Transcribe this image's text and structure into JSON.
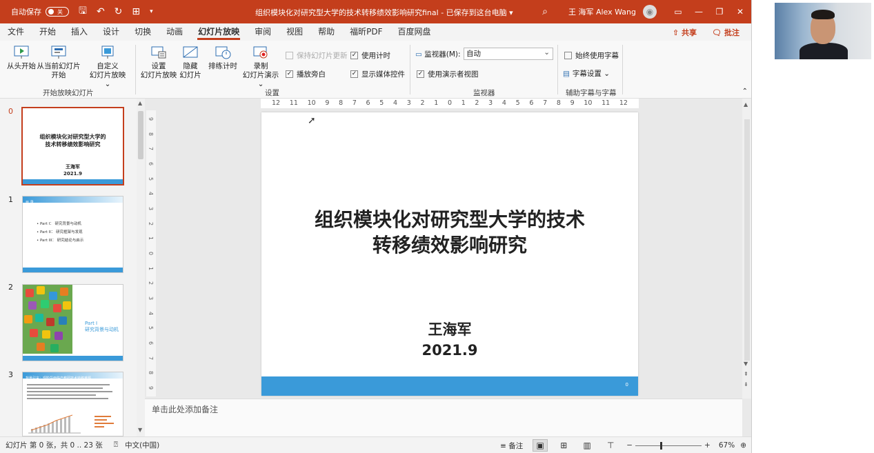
{
  "titlebar": {
    "autosave_label": "自动保存",
    "autosave_state": "关",
    "doc_title": "组织模块化对研究型大学的技术转移绩效影响研究final - 已保存到这台电脑 ▾",
    "user_name": "王 海军 Alex Wang"
  },
  "menu": {
    "tabs": [
      "文件",
      "开始",
      "插入",
      "设计",
      "切换",
      "动画",
      "幻灯片放映",
      "审阅",
      "视图",
      "帮助",
      "福昕PDF",
      "百度网盘"
    ],
    "active_tab": "幻灯片放映",
    "share": "共享",
    "comments": "批注"
  },
  "ribbon": {
    "from_beginning": "从头开始",
    "from_current_1": "从当前幻灯片",
    "from_current_2": "开始",
    "custom_1": "自定义",
    "custom_2": "幻灯片放映 ⌄",
    "group_start": "开始放映幻灯片",
    "setup_1": "设置",
    "setup_2": "幻灯片放映",
    "hide_1": "隐藏",
    "hide_2": "幻灯片",
    "rehearse": "排练计时",
    "record_1": "录制",
    "record_2": "幻灯片演示 ⌄",
    "keep_updated": "保持幻灯片更新",
    "use_timings": "使用计时",
    "play_narrations": "播放旁白",
    "show_media": "显示媒体控件",
    "group_setup": "设置",
    "monitor_label": "监视器(M):",
    "monitor_value": "自动",
    "presenter_view": "使用演示者视图",
    "group_monitor": "监视器",
    "always_subtitles": "始终使用字幕",
    "subtitle_settings": "字幕设置 ⌄",
    "group_captions": "辅助字幕与字幕"
  },
  "thumbnails": {
    "items": [
      {
        "num": "0",
        "title": "组织模块化对研究型大学的技术转移绩效影响研究",
        "name": "王海军",
        "date": "2021.9"
      },
      {
        "num": "1",
        "header": "目 录",
        "list": [
          "• Part I： 研究背景与动机",
          "• Part II： 研究框架与发现",
          "• Part III： 研究结论与启示"
        ]
      },
      {
        "num": "2",
        "part": "Part I",
        "part_sub": "研究背景与动机"
      },
      {
        "num": "3",
        "header": "背景引言：现阶段面临产教研技术转移难题"
      }
    ]
  },
  "ruler": {
    "h": [
      "12",
      "11",
      "10",
      "9",
      "8",
      "7",
      "6",
      "5",
      "4",
      "3",
      "2",
      "1",
      "0",
      "1",
      "2",
      "3",
      "4",
      "5",
      "6",
      "7",
      "8",
      "9",
      "10",
      "11",
      "12"
    ],
    "v": [
      "9",
      "8",
      "7",
      "6",
      "5",
      "4",
      "3",
      "2",
      "1",
      "0",
      "1",
      "2",
      "3",
      "4",
      "5",
      "6",
      "7",
      "8",
      "9"
    ]
  },
  "slide": {
    "title_line1": "组织模块化对研究型大学的技术",
    "title_line2": "转移绩效影响研究",
    "author": "王海军",
    "date": "2021.9",
    "page_num": "0"
  },
  "notes_placeholder": "单击此处添加备注",
  "status": {
    "slide_info": "幻灯片 第 0 张，共 0 .. 23 张",
    "language": "中文(中国)",
    "notes": "备注",
    "zoom": "67%"
  }
}
